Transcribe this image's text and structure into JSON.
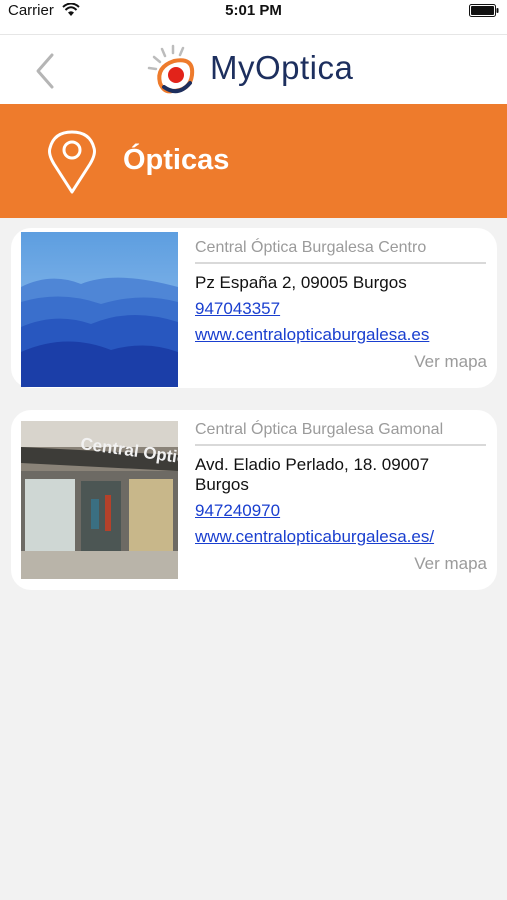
{
  "status_bar": {
    "carrier": "Carrier",
    "time": "5:01 PM"
  },
  "nav": {
    "app_title": "MyOptica"
  },
  "header": {
    "title": "Ópticas"
  },
  "stores": [
    {
      "name": "Central Óptica Burgalesa Centro",
      "address": "Pz España 2, 09005 Burgos",
      "phone": "947043357",
      "website": "www.centralopticaburgalesa.es",
      "map_label": "Ver mapa"
    },
    {
      "name": "Central Óptica Burgalesa Gamonal",
      "address": "Avd. Eladio Perlado, 18. 09007 Burgos",
      "phone": "947240970",
      "website": "www.centralopticaburgalesa.es/",
      "map_label": "Ver mapa",
      "photo_sign": "Central Optic"
    }
  ],
  "colors": {
    "accent": "#ee7b2c",
    "brand_text": "#1d2f5e",
    "link": "#1a3fcf"
  }
}
